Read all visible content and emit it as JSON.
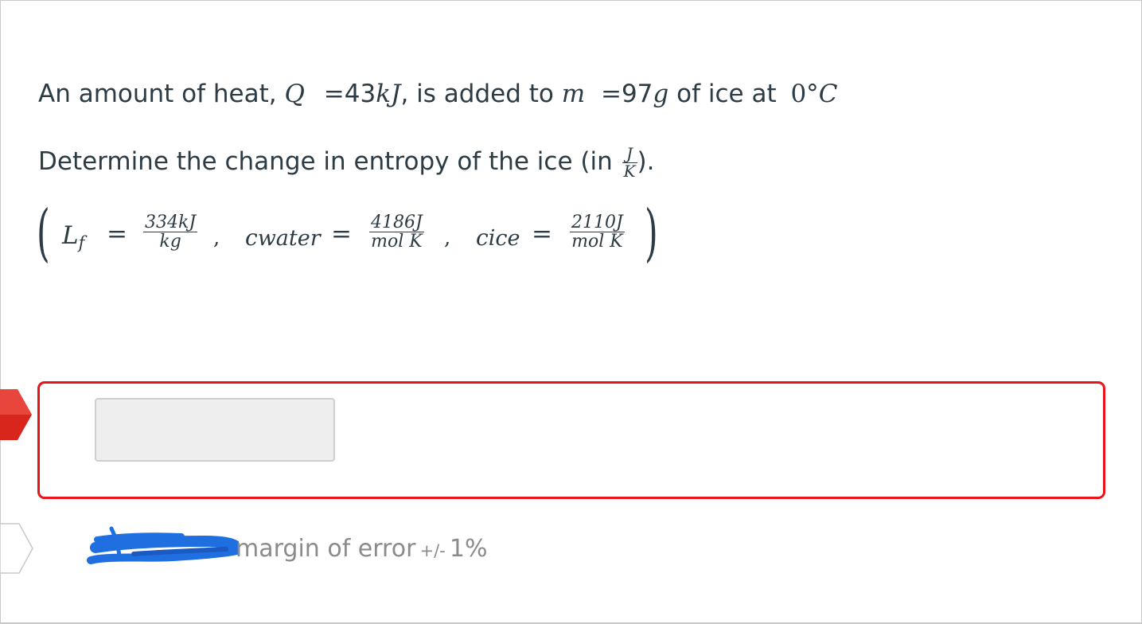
{
  "question": {
    "line1": {
      "prefix": "An amount of heat,",
      "q_var": "Q",
      "eq1": "=",
      "q_num": "43",
      "q_unit": "kJ",
      "middle": ", is added to",
      "m_var": "m",
      "eq2": "=",
      "m_num": "97",
      "m_unit": "g",
      "suffix": "of ice at",
      "temp": "0°",
      "temp_unit": "C"
    },
    "line2": {
      "prefix": "Determine the change in entropy of the ice (in",
      "unit_num": "J",
      "unit_den": "K",
      "suffix": ")."
    },
    "constants": {
      "lf_label": "L",
      "lf_sub": "f",
      "lf_num": "334kJ",
      "lf_den": "kg",
      "cw_label": "c",
      "cw_sub": "water",
      "cw_num": "4186J",
      "cw_den": "mol K",
      "ci_label": "c",
      "ci_sub": "ice",
      "ci_num": "2110J",
      "ci_den": "mol K",
      "equals": "=",
      "comma": ",",
      "open_paren": "(",
      "close_paren": ")"
    }
  },
  "answer": {
    "value": "",
    "status_color": "#e8141a"
  },
  "tolerance": {
    "label": "margin of error",
    "plusminus": "+/-",
    "percent": "1%"
  },
  "icons": {
    "incorrect_flag": "incorrect-answer-flag-icon",
    "answer_flag": "correct-answer-flag-icon",
    "redaction": "redaction-scribble"
  }
}
